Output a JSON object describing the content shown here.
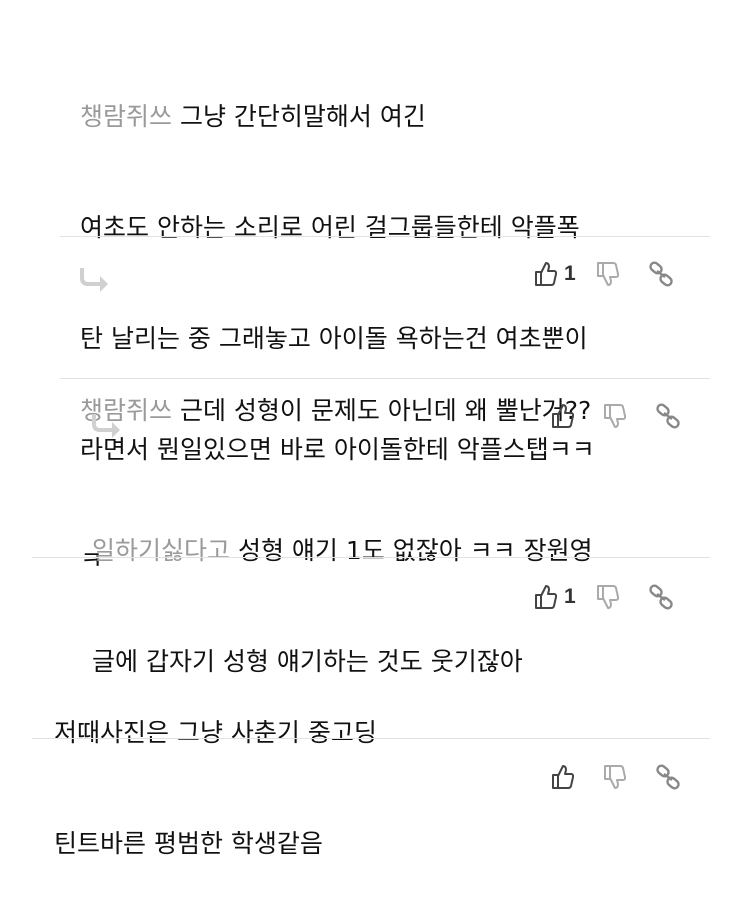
{
  "comments": [
    {
      "author": "챙람쥐쓰",
      "lines": [
        "그냥 간단히말해서 여긴",
        "여초도 안하는 소리로 어린 걸그룹들한테 악플폭",
        "탄 날리는 중 그래놓고 아이돌 욕하는건 여초뿐이",
        "라면서 뭔일있으면 바로 아이돌한테 악플스탭ㅋㅋ",
        "ㅋ"
      ],
      "likes": "1"
    },
    {
      "author": "챙람쥐쓰",
      "lines": [
        "근데 성형이 문제도 아닌데 왜 뿔난거??"
      ],
      "likes": ""
    },
    {
      "author": "일하기싫다고",
      "lines": [
        "성형 얘기 1도 없잖아 ㅋㅋ 장원영",
        "글에 갑자기 성형 얘기하는 것도 웃기잖아"
      ],
      "likes": "1"
    },
    {
      "author": "",
      "lines": [
        "저때사진은 그냥 사춘기 중고딩",
        "틴트바른 평범한 학생같음"
      ],
      "likes": ""
    }
  ],
  "icons": {
    "like": "thumbs-up-icon",
    "dislike": "thumbs-down-icon",
    "link": "link-icon",
    "reply": "reply-arrow-icon"
  },
  "colors": {
    "author": "#9a9a9a",
    "text": "#111111",
    "icon": "#555555",
    "reply_arrow": "#d0d0d0",
    "divider": "#e2e2e2"
  }
}
